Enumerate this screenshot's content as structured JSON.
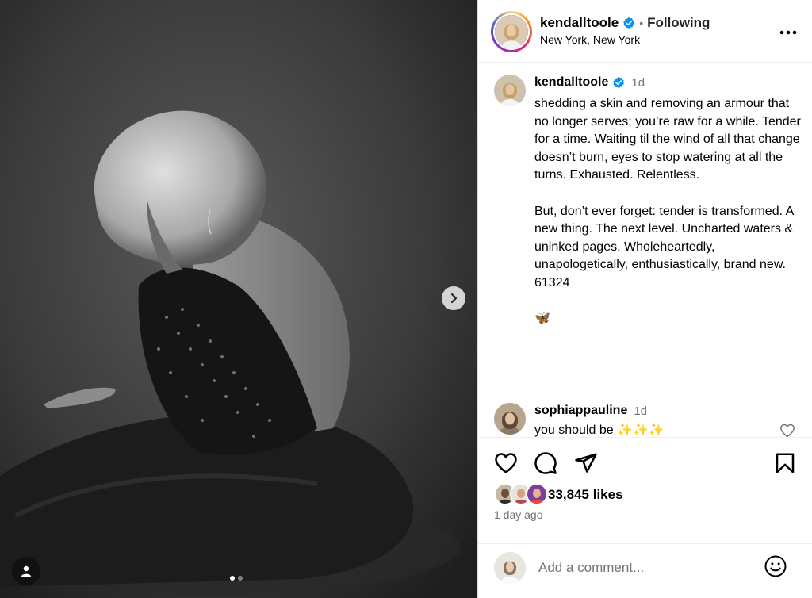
{
  "post": {
    "username": "kendalltoole",
    "follow_status": "Following",
    "separator": "•",
    "location": "New York, New York",
    "verified_color": "#0095f6"
  },
  "media": {
    "carousel_total": 2,
    "carousel_current": 1,
    "next_icon": "chevron-right-icon",
    "tag_icon": "person-icon"
  },
  "caption": {
    "username": "kendalltoole",
    "time": "1d",
    "text": "shedding a skin and removing an armour that no longer serves; you’re raw for a while. Tender for a time. Waiting til the wind of all that change doesn’t burn, eyes to stop watering at all the turns. Exhausted. Relentless.\n\nBut, don’t ever forget: tender is transformed. A new thing. The next level. Uncharted waters & uninked pages. Wholeheartedly, unapologetically, enthusiastically, brand new.\n61324\n\n🦋"
  },
  "comments": [
    {
      "username": "sophiappauline",
      "time": "1d",
      "text": "you should be ✨✨✨"
    }
  ],
  "actions": {
    "likes": "33,845 likes",
    "time_ago": "1 day ago",
    "icons": [
      "heart-icon",
      "comment-icon",
      "share-icon",
      "bookmark-icon"
    ]
  },
  "add_comment": {
    "placeholder": "Add a comment..."
  }
}
